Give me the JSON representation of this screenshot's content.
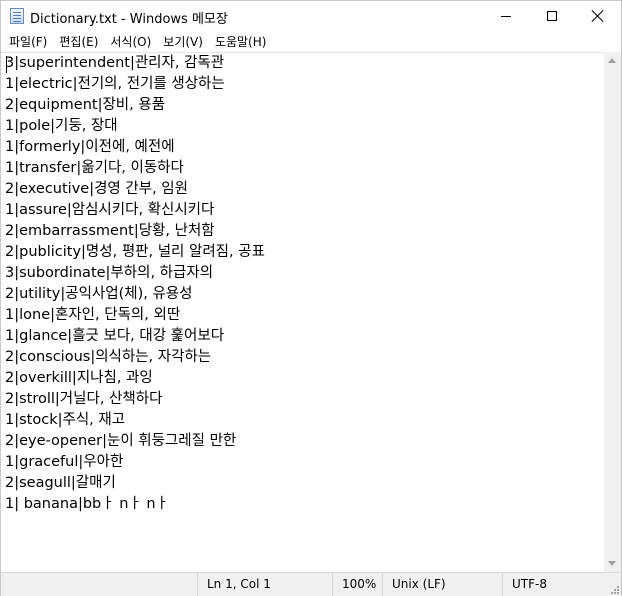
{
  "window": {
    "title": "Dictionary.txt - Windows 메모장"
  },
  "menu": [
    {
      "label": "파일(F)"
    },
    {
      "label": "편집(E)"
    },
    {
      "label": "서식(O)"
    },
    {
      "label": "보기(V)"
    },
    {
      "label": "도움말(H)"
    }
  ],
  "editor": {
    "lines": [
      "3|superintendent|관리자, 감독관",
      "1|electric|전기의, 전기를 생상하는",
      "2|equipment|장비, 용품",
      "1|pole|기둥, 장대",
      "1|formerly|이전에, 예전에",
      "1|transfer|옮기다, 이동하다",
      "2|executive|경영 간부, 임원",
      "1|assure|암심시키다, 확신시키다",
      "2|embarrassment|당황, 난처함",
      "2|publicity|명성, 평판, 널리 알려짐, 공표",
      "3|subordinate|부하의, 하급자의",
      "2|utility|공익사업(체), 유용성",
      "1|lone|혼자인, 단독의, 외딴",
      "1|glance|흘긋 보다, 대강 훑어보다",
      "2|conscious|의식하는, 자각하는",
      "2|overkill|지나침, 과잉",
      "2|stroll|거닐다, 산책하다",
      "1|stock|주식, 재고",
      "2|eye-opener|눈이 휘둥그레질 만한",
      "1|graceful|우아한",
      "2|seagull|갈매기",
      "1| banana|bbㅏ nㅏ nㅏ"
    ]
  },
  "status": {
    "position": "Ln 1, Col 1",
    "zoom": "100%",
    "line_ending": "Unix (LF)",
    "encoding": "UTF-8"
  },
  "icons": {
    "app": "notepad-icon",
    "minimize": "minimize-icon",
    "maximize": "maximize-icon",
    "close": "close-icon"
  }
}
